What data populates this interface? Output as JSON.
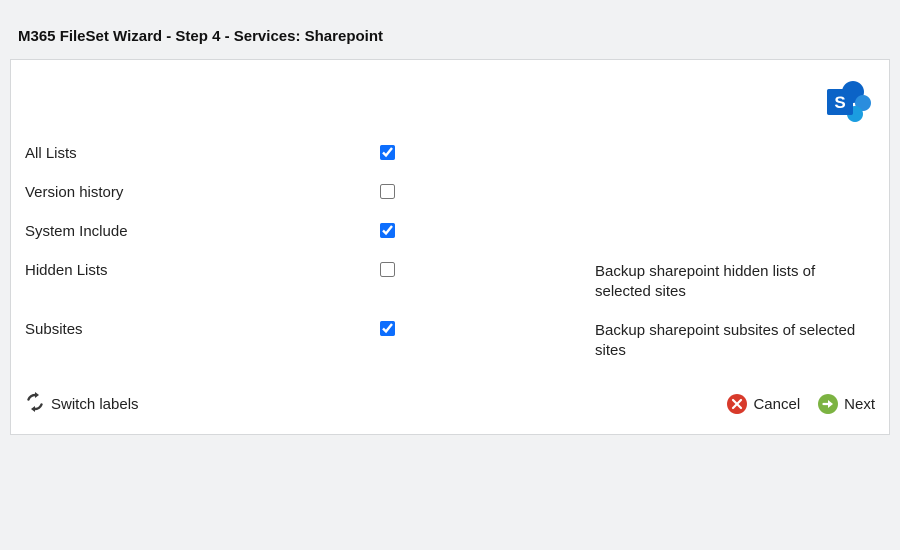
{
  "page_title": "M365 FileSet Wizard - Step 4 - Services: Sharepoint",
  "options": [
    {
      "label": "All Lists",
      "checked": true,
      "desc": ""
    },
    {
      "label": "Version history",
      "checked": false,
      "desc": ""
    },
    {
      "label": "System Include",
      "checked": true,
      "desc": ""
    },
    {
      "label": "Hidden Lists",
      "checked": false,
      "desc": "Backup sharepoint hidden lists of selected sites"
    },
    {
      "label": "Subsites",
      "checked": true,
      "desc": "Backup sharepoint subsites of selected sites"
    }
  ],
  "footer": {
    "switch_labels": "Switch labels",
    "cancel": "Cancel",
    "next": "Next"
  }
}
